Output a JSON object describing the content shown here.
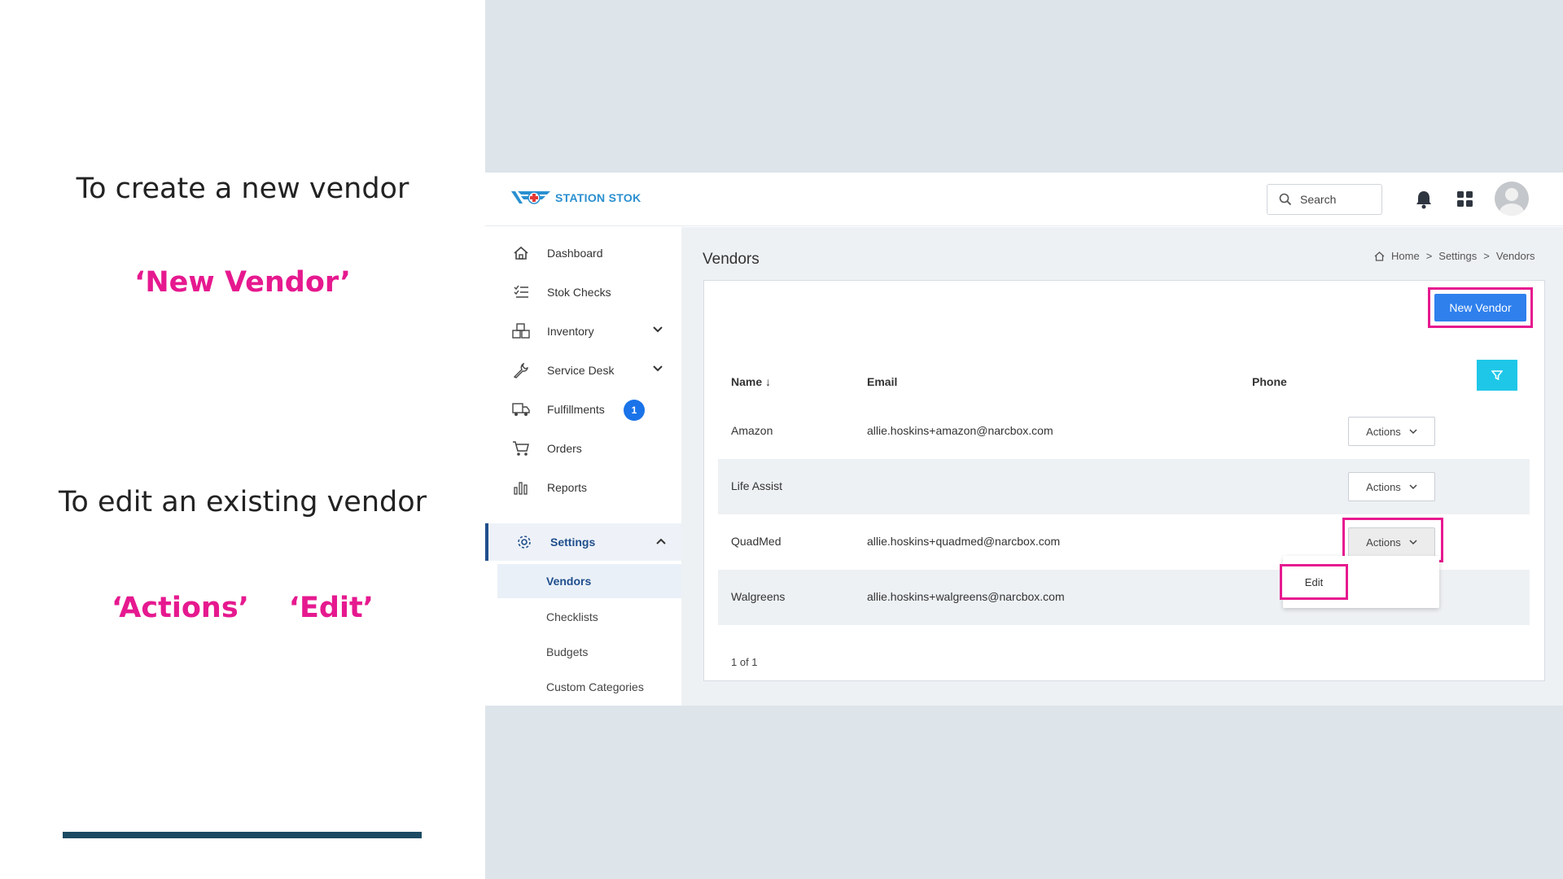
{
  "instructions": {
    "create_heading": "To create a new vendor",
    "create_hint": "‘New Vendor’",
    "edit_heading": "To edit an existing vendor",
    "edit_hint": "‘Actions’    ‘Edit’"
  },
  "brand": {
    "logo_text": "STATION STOK",
    "accent": "#e6198f",
    "primary": "#2f80ed"
  },
  "topbar": {
    "search_label": "Search"
  },
  "sidebar": {
    "items": [
      {
        "label": "Dashboard",
        "icon": "home-icon"
      },
      {
        "label": "Stok Checks",
        "icon": "checklist-icon"
      },
      {
        "label": "Inventory",
        "icon": "boxes-icon"
      },
      {
        "label": "Service Desk",
        "icon": "wrench-icon"
      },
      {
        "label": "Fulfillments",
        "icon": "truck-icon",
        "badge": "1"
      },
      {
        "label": "Orders",
        "icon": "cart-icon"
      },
      {
        "label": "Reports",
        "icon": "bar-chart-icon"
      },
      {
        "label": "Settings",
        "icon": "gear-icon"
      }
    ],
    "settings_sub": [
      "Vendors",
      "Checklists",
      "Budgets",
      "Custom Categories"
    ]
  },
  "page": {
    "title": "Vendors",
    "breadcrumb": [
      "Home",
      "Settings",
      "Vendors"
    ],
    "new_vendor_label": "New Vendor",
    "columns": {
      "name": "Name ↓",
      "email": "Email",
      "phone": "Phone"
    },
    "rows": [
      {
        "name": "Amazon",
        "email": "allie.hoskins+amazon@narcbox.com",
        "phone": ""
      },
      {
        "name": "Life Assist",
        "email": "",
        "phone": ""
      },
      {
        "name": "QuadMed",
        "email": "allie.hoskins+quadmed@narcbox.com",
        "phone": ""
      },
      {
        "name": "Walgreens",
        "email": "allie.hoskins+walgreens@narcbox.com",
        "phone": ""
      }
    ],
    "actions_label": "Actions",
    "dropdown_edit": "Edit",
    "pager": "1 of 1"
  }
}
